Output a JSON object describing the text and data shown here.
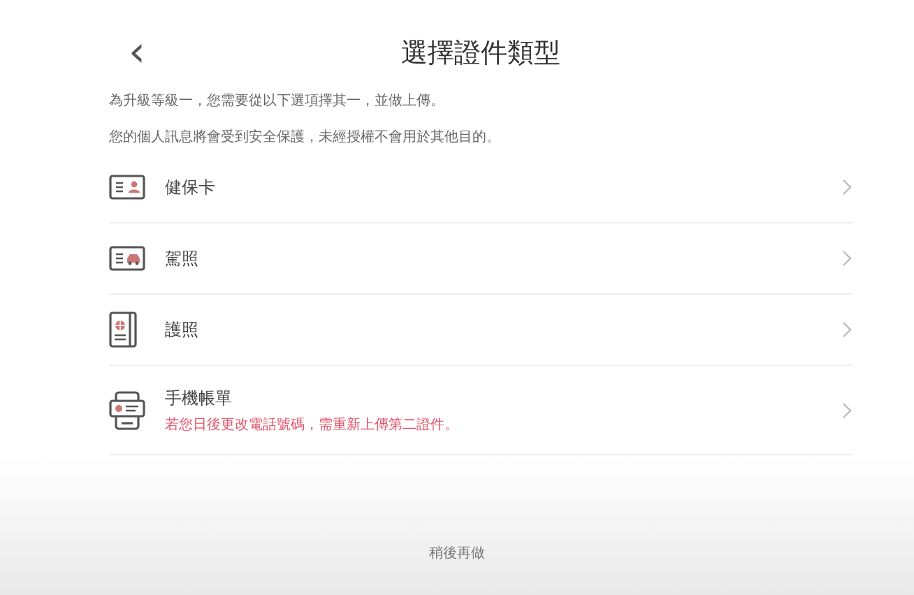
{
  "header": {
    "back": "‹",
    "title": "選擇證件類型"
  },
  "intro": [
    "為升級等級一，您需要從以下選項擇其一，並做上傳。",
    "您的個人訊息將會受到安全保護，未經授權不會用於其他目的。"
  ],
  "options": [
    {
      "kind": "id-card",
      "label": "健保卡"
    },
    {
      "kind": "license",
      "label": "駕照"
    },
    {
      "kind": "passport",
      "label": "護照"
    },
    {
      "kind": "phone",
      "label": "手機帳單",
      "note": "若您日後更改電話號碼，需重新上傳第二證件。"
    }
  ],
  "footer": {
    "later": "稍後再做"
  }
}
